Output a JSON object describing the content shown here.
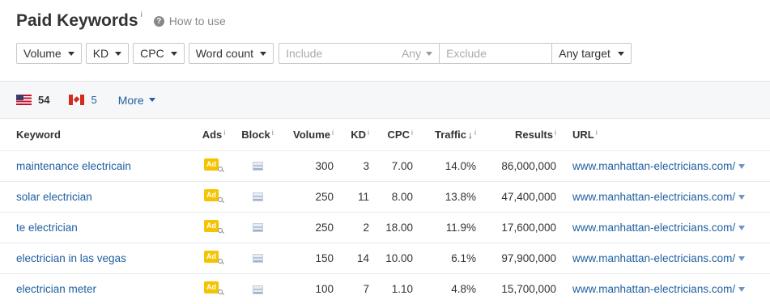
{
  "header": {
    "title": "Paid Keywords",
    "info_mark": "i",
    "how_to": "How to use",
    "help_glyph": "?"
  },
  "filters": {
    "volume": "Volume",
    "kd": "KD",
    "cpc": "CPC",
    "word_count": "Word count",
    "include_placeholder": "Include",
    "any": "Any",
    "exclude_placeholder": "Exclude",
    "target": "Any target"
  },
  "countries": [
    {
      "flag": "us-flag-icon",
      "count": "54"
    },
    {
      "flag": "canada-flag-icon",
      "count": "5"
    }
  ],
  "more": "More",
  "table": {
    "columns": {
      "keyword": "Keyword",
      "ads": "Ads",
      "block": "Block",
      "volume": "Volume",
      "kd": "KD",
      "cpc": "CPC",
      "traffic": "Traffic",
      "results": "Results",
      "url": "URL"
    },
    "info_mark": "i",
    "sort_arrow": "↓",
    "ad_label": "Ad",
    "rows": [
      {
        "keyword": "maintenance electricain",
        "volume": "300",
        "kd": "3",
        "cpc": "7.00",
        "traffic": "14.0%",
        "results": "86,000,000",
        "url": "www.manhattan-electricians.com/"
      },
      {
        "keyword": "solar electrician",
        "volume": "250",
        "kd": "11",
        "cpc": "8.00",
        "traffic": "13.8%",
        "results": "47,400,000",
        "url": "www.manhattan-electricians.com/"
      },
      {
        "keyword": "te electrician",
        "volume": "250",
        "kd": "2",
        "cpc": "18.00",
        "traffic": "11.9%",
        "results": "17,600,000",
        "url": "www.manhattan-electricians.com/"
      },
      {
        "keyword": "electrician in las vegas",
        "volume": "150",
        "kd": "14",
        "cpc": "10.00",
        "traffic": "6.1%",
        "results": "97,900,000",
        "url": "www.manhattan-electricians.com/"
      },
      {
        "keyword": "electrician meter",
        "volume": "100",
        "kd": "7",
        "cpc": "1.10",
        "traffic": "4.8%",
        "results": "15,700,000",
        "url": "www.manhattan-electricians.com/"
      }
    ]
  },
  "colors": {
    "link": "#1f5fa0",
    "ad_badge": "#f5c400",
    "bar_background": "#f5f7f9"
  }
}
